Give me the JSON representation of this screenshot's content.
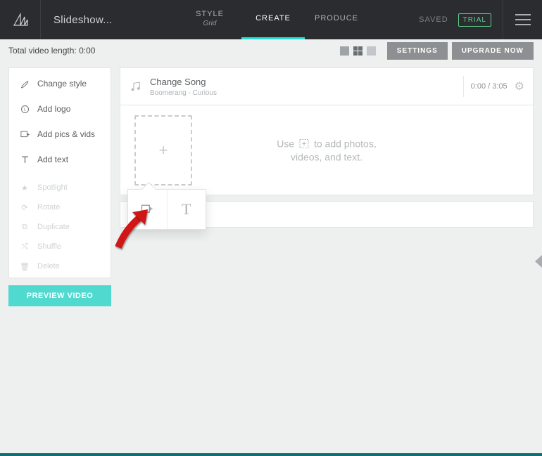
{
  "header": {
    "title": "Slideshow...",
    "nav": {
      "style": {
        "label": "STYLE",
        "sub": "Grid"
      },
      "create": {
        "label": "CREATE"
      },
      "produce": {
        "label": "PRODUCE"
      }
    },
    "saved": "SAVED",
    "trial": "TRIAL"
  },
  "subbar": {
    "length_label": "Total video length: 0:00",
    "settings": "SETTINGS",
    "upgrade": "UPGRADE NOW"
  },
  "sidebar": {
    "items": [
      {
        "label": "Change style"
      },
      {
        "label": "Add logo"
      },
      {
        "label": "Add pics & vids"
      },
      {
        "label": "Add text"
      }
    ],
    "disabled": [
      {
        "label": "Spotlight"
      },
      {
        "label": "Rotate"
      },
      {
        "label": "Duplicate"
      },
      {
        "label": "Shuffle"
      },
      {
        "label": "Delete"
      }
    ],
    "preview": "PREVIEW VIDEO"
  },
  "song": {
    "change": "Change Song",
    "track": "Boomerang - Curious",
    "time": "0:00 / 3:05"
  },
  "dropzone": {
    "text_prefix": "Use",
    "text_line1_suffix": "to add photos,",
    "text_line2": "videos, and text."
  }
}
